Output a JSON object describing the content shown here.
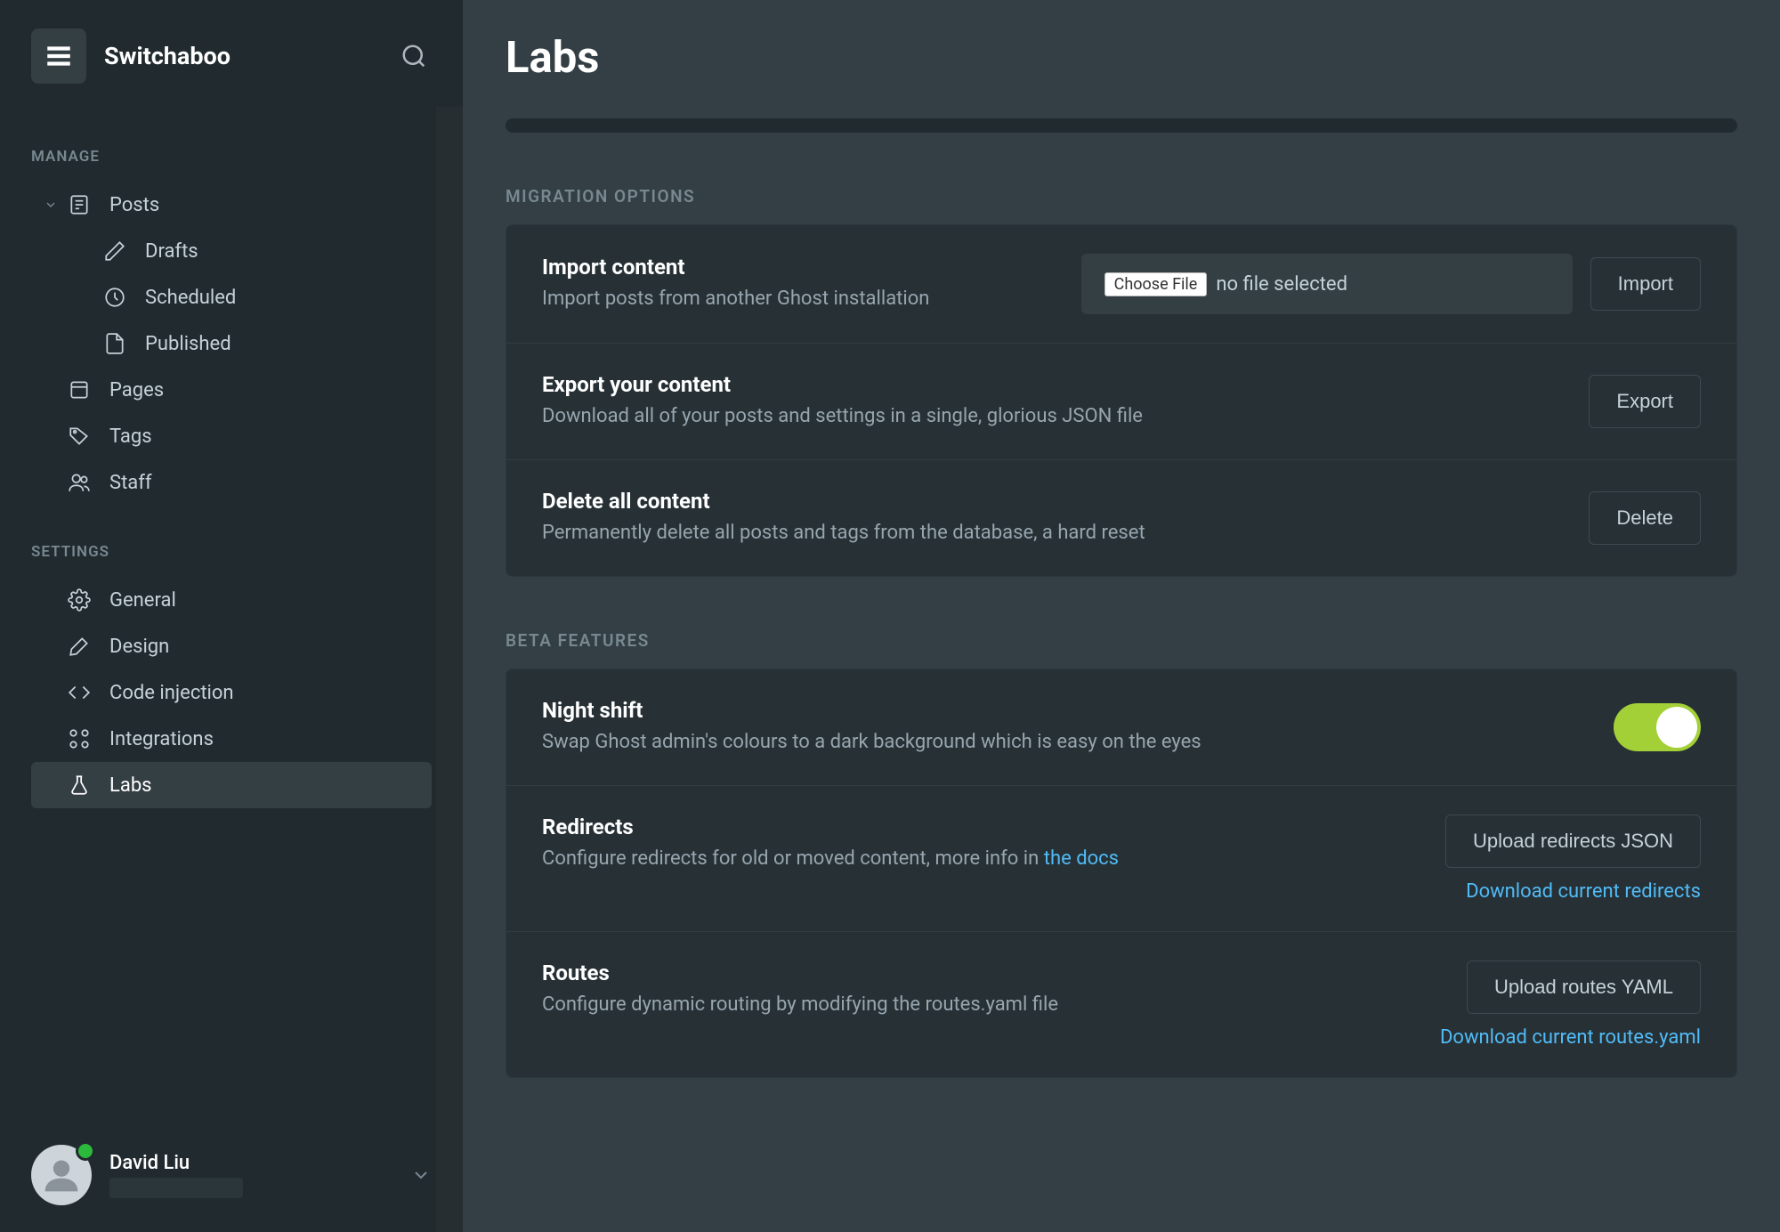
{
  "header": {
    "site_title": "Switchaboo"
  },
  "sidebar": {
    "manage_heading": "MANAGE",
    "settings_heading": "SETTINGS",
    "posts": "Posts",
    "drafts": "Drafts",
    "scheduled": "Scheduled",
    "published": "Published",
    "pages": "Pages",
    "tags": "Tags",
    "staff": "Staff",
    "general": "General",
    "design": "Design",
    "code_injection": "Code injection",
    "integrations": "Integrations",
    "labs": "Labs"
  },
  "user": {
    "name": "David Liu",
    "email_redacted": "                              "
  },
  "page": {
    "title": "Labs",
    "migration_heading": "MIGRATION OPTIONS",
    "beta_heading": "BETA FEATURES",
    "import": {
      "title": "Import content",
      "desc": "Import posts from another Ghost installation",
      "choose_label": "Choose File",
      "no_file": "no file selected",
      "button": "Import"
    },
    "export": {
      "title": "Export your content",
      "desc": "Download all of your posts and settings in a single, glorious JSON file",
      "button": "Export"
    },
    "delete": {
      "title": "Delete all content",
      "desc": "Permanently delete all posts and tags from the database, a hard reset",
      "button": "Delete"
    },
    "night": {
      "title": "Night shift",
      "desc": "Swap Ghost admin's colours to a dark background which is easy on the eyes"
    },
    "redirects": {
      "title": "Redirects",
      "desc_prefix": "Configure redirects for old or moved content, more info in ",
      "desc_link": "the docs",
      "upload": "Upload redirects JSON",
      "download": "Download current redirects"
    },
    "routes": {
      "title": "Routes",
      "desc": "Configure dynamic routing by modifying the routes.yaml file",
      "upload": "Upload routes YAML",
      "download": "Download current routes.yaml"
    }
  }
}
